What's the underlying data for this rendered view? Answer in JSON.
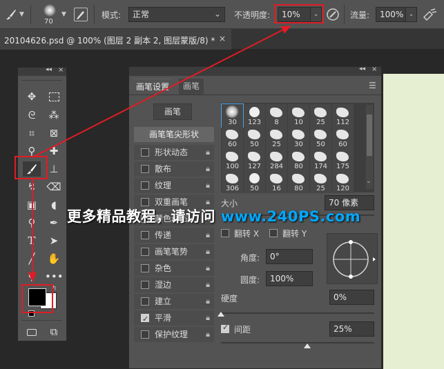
{
  "options_bar": {
    "brush_size": "70",
    "mode_label": "模式:",
    "mode_value": "正常",
    "opacity_label": "不透明度:",
    "opacity_value": "10%",
    "flow_label": "流量:",
    "flow_value": "100%"
  },
  "document_tab": {
    "title": "20104626.psd @ 100% (图层 2 副本 2, 图层蒙版/8) *",
    "close": "×"
  },
  "brush_panel": {
    "tabs": [
      "画笔设置",
      "画笔"
    ],
    "brushes_button": "画笔",
    "tip_shape_label": "画笔笔尖形状",
    "options": [
      {
        "label": "形状动态",
        "checked": false
      },
      {
        "label": "散布",
        "checked": false
      },
      {
        "label": "纹理",
        "checked": false
      },
      {
        "label": "双重画笔",
        "checked": false
      },
      {
        "label": "颜色动态",
        "checked": false
      },
      {
        "label": "传递",
        "checked": false
      },
      {
        "label": "画笔笔势",
        "checked": false
      },
      {
        "label": "杂色",
        "checked": false
      },
      {
        "label": "湿边",
        "checked": false
      },
      {
        "label": "建立",
        "checked": false
      },
      {
        "label": "平滑",
        "checked": true
      },
      {
        "label": "保护纹理",
        "checked": false
      }
    ],
    "presets": [
      "30",
      "123",
      "8",
      "10",
      "25",
      "112",
      "60",
      "50",
      "25",
      "30",
      "50",
      "60",
      "100",
      "127",
      "284",
      "80",
      "174",
      "175",
      "306",
      "50",
      "16",
      "80",
      "25",
      "120"
    ],
    "size_label": "大小",
    "size_value": "70 像素",
    "flip_x_label": "翻转 X",
    "flip_y_label": "翻转 Y",
    "angle_label": "角度:",
    "angle_value": "0°",
    "roundness_label": "圆度:",
    "roundness_value": "100%",
    "hardness_label": "硬度",
    "hardness_value": "0%",
    "spacing_label": "间距",
    "spacing_value": "25%",
    "spacing_checked": true,
    "hardness_fraction": 0.0,
    "spacing_fraction": 0.25
  },
  "watermark": {
    "text": "更多精品教程，请访问 ",
    "url": "www.240PS.com"
  },
  "colors": {
    "annotation_red": "#e11c24",
    "foreground": "#000000",
    "background": "#ffffff",
    "canvas": "#e6efd2"
  }
}
